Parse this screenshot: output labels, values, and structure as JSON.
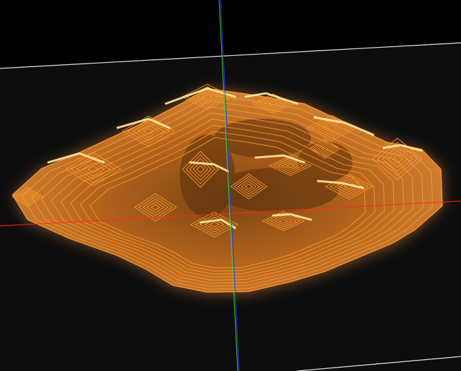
{
  "viewport": {
    "background_color": "#000000",
    "ground_plane_color": "#0d0d0d",
    "grid_line_color": "#e6e6e6",
    "axis_colors": {
      "x": "#ff2a1a",
      "y": "#36d936",
      "z": "#2a3cff"
    }
  },
  "surface": {
    "type": "3d-terrain-contour-surface",
    "fill_color": "#b8661e",
    "contour_color": "#ff9a2e",
    "highlight_color": "#ffe9a0",
    "glow_color": "#ffd080"
  },
  "icons": {
    "axis_gizmo": "xyz-axis-lines"
  }
}
